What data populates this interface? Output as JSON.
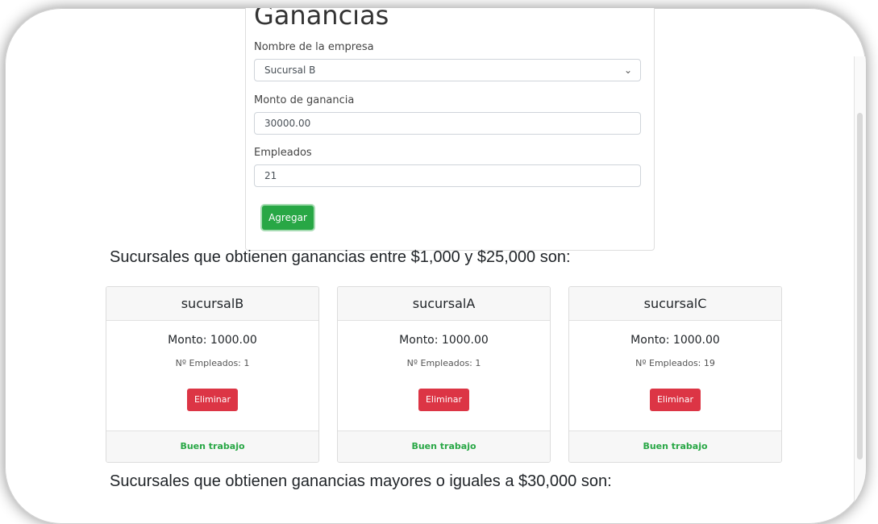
{
  "form": {
    "title": "Ganancias",
    "company_label": "Nombre de la empresa",
    "company_value": "Sucursal B",
    "amount_label": "Monto de ganancia",
    "amount_value": "30000.00",
    "employees_label": "Empleados",
    "employees_value": "21",
    "add_button": "Agregar"
  },
  "section1": {
    "heading": "Sucursales que obtienen ganancias entre $1,000 y $25,000 son:",
    "cards": [
      {
        "name": "sucursalB",
        "monto": "Monto: 1000.00",
        "empleados": "Nº Empleados: 1",
        "delete": "Eliminar",
        "footer": "Buen trabajo"
      },
      {
        "name": "sucursalA",
        "monto": "Monto: 1000.00",
        "empleados": "Nº Empleados: 1",
        "delete": "Eliminar",
        "footer": "Buen trabajo"
      },
      {
        "name": "sucursalC",
        "monto": "Monto: 1000.00",
        "empleados": "Nº Empleados: 19",
        "delete": "Eliminar",
        "footer": "Buen trabajo"
      }
    ]
  },
  "section2": {
    "heading": "Sucursales que obtienen ganancias mayores o iguales a $30,000 son:"
  },
  "colors": {
    "success": "#28a745",
    "danger": "#dc3545"
  },
  "icons": {
    "select_arrow": "chevron-down-icon"
  }
}
